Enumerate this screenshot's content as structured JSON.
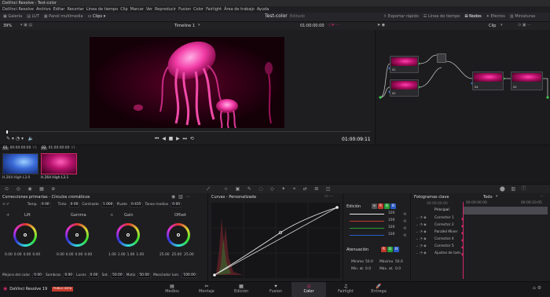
{
  "titlebar": {
    "title": "DaVinci Resolve - Test-color"
  },
  "menu": [
    "DaVinci Resolve",
    "Archivo",
    "Editar",
    "Recortar",
    "Línea de tiempo",
    "Clip",
    "Marcar",
    "Ver",
    "Reproducir",
    "Fusion",
    "Color",
    "Fairlight",
    "Área de trabajo",
    "Ayuda"
  ],
  "toolbar": {
    "left": [
      "Galería",
      "LUT",
      "Panel multimedia",
      "Clips"
    ],
    "project": "Test-color",
    "status": "Editado",
    "right": [
      "Exportar rápido",
      "Línea de tiempo",
      "Nodos",
      "Efectos",
      "Miniaturas"
    ]
  },
  "viewerbar": {
    "zoom": "39%",
    "timeline": "Timeline 1",
    "timecode": "01:00:00:00",
    "clip_mode": "Clip"
  },
  "transport": {
    "timecode": "01:00:09:11"
  },
  "clips": {
    "header": [
      {
        "num": "01",
        "tc": "00:00:00:00",
        "track": "V1"
      },
      {
        "num": "02",
        "tc": "01:00:00:00",
        "track": "V1"
      }
    ],
    "items": [
      {
        "codec": "H.264 High L3.0"
      },
      {
        "codec": "H.264 High L3.1"
      }
    ]
  },
  "nodes": [
    {
      "num": "01"
    },
    {
      "num": "02"
    },
    {
      "num": "04"
    },
    {
      "num": "05"
    }
  ],
  "wheels": {
    "title": "Correcciones primarias - Círculos cromáticos",
    "params": [
      {
        "label": "Temp.",
        "value": "0.00"
      },
      {
        "label": "Tinte",
        "value": "0.00"
      },
      {
        "label": "Contraste",
        "value": "1.000"
      },
      {
        "label": "Pivote",
        "value": "0.435"
      },
      {
        "label": "Tonos medios",
        "value": "0.00"
      }
    ],
    "items": [
      {
        "name": "Lift",
        "values": [
          "0.00",
          "0.00",
          "0.00",
          "0.00"
        ]
      },
      {
        "name": "Gamma",
        "values": [
          "0.00",
          "0.00",
          "0.00",
          "0.00"
        ]
      },
      {
        "name": "Gain",
        "values": [
          "1.00",
          "1.00",
          "1.00",
          "1.00"
        ]
      },
      {
        "name": "Offset",
        "values": [
          "25.00",
          "25.00",
          "25.00"
        ]
      }
    ],
    "bottom": [
      {
        "label": "Mejora del color",
        "value": "0.00"
      },
      {
        "label": "Sombras",
        "value": "0.00"
      },
      {
        "label": "Luces",
        "value": "0.00"
      },
      {
        "label": "Sat.",
        "value": "50.00"
      },
      {
        "label": "Matiz",
        "value": "50.00"
      },
      {
        "label": "Mezclador lum.",
        "value": "100.00"
      }
    ]
  },
  "curves": {
    "title": "Curvas - Personalizada"
  },
  "edit": {
    "title": "Edición",
    "values": [
      "100",
      "100",
      "100",
      "100"
    ],
    "atten_title": "Atenuación",
    "min_label": "Mínimo",
    "min_value": "50.0",
    "max_label": "Máximo",
    "max_value": "50.0",
    "minat_label": "Mín. at.",
    "minat_value": "0.0",
    "maxat_label": "Máx. at.",
    "maxat_value": "0.0"
  },
  "keyframes": {
    "title": "Fotogramas clave",
    "filter": "Todo",
    "tc1": "00:00:00:00",
    "tc2": "00:00:00:00",
    "tc3": "00:00:10:05",
    "rows": [
      "Principal",
      "Corrector 1",
      "Corrector 2",
      "Parallel Mixer",
      "Corrector 4",
      "Corrector 5",
      "Ajustes de tam..."
    ]
  },
  "pages": {
    "app": "DaVinci Resolve 19",
    "beta": "PUBLIC BETA",
    "items": [
      "Medios",
      "Montaje",
      "Edición",
      "Fusion",
      "Color",
      "Fairlight",
      "Entrega"
    ],
    "active": "Color"
  },
  "colors": {
    "accent": "#d4286a",
    "badge": "#c0392b"
  }
}
